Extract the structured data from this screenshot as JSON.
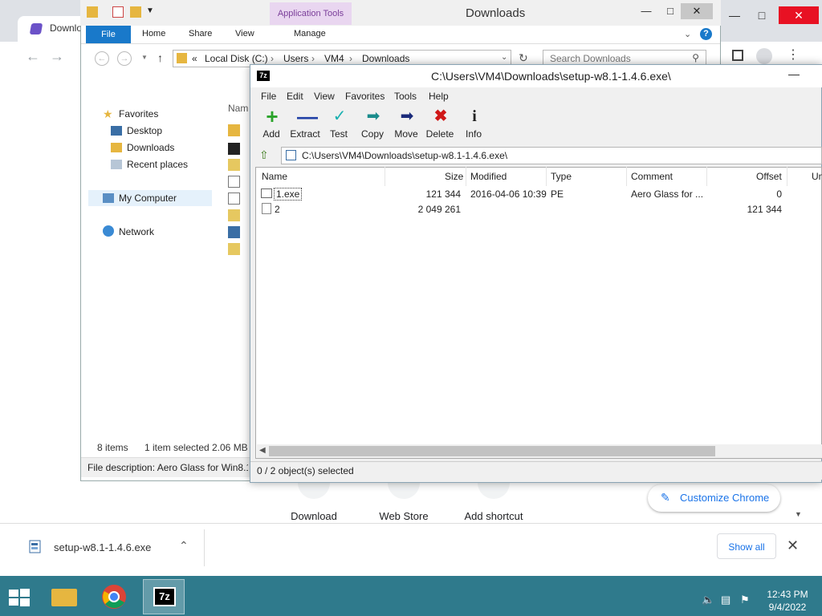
{
  "chrome": {
    "tab_title": "Downlo",
    "ntp_shortcuts": [
      "Download",
      "Web Store",
      "Add shortcut"
    ],
    "customize_label": "Customize Chrome",
    "download_shelf": {
      "filename": "setup-w8.1-1.4.6.exe",
      "show_all": "Show all"
    }
  },
  "explorer": {
    "title": "Downloads",
    "contextual_tab": "Application Tools",
    "ribbon_tabs": [
      "File",
      "Home",
      "Share",
      "View",
      "Manage"
    ],
    "breadcrumb": [
      "Local Disk (C:)",
      "Users",
      "VM4",
      "Downloads"
    ],
    "breadcrumb_overflow": "«",
    "search_placeholder": "Search Downloads",
    "nav": {
      "favorites": "Favorites",
      "desktop": "Desktop",
      "downloads": "Downloads",
      "recent": "Recent places",
      "mycomputer": "My Computer",
      "network": "Network"
    },
    "list_header_name": "Nam",
    "status_items": "8 items",
    "status_selected": "1 item selected",
    "status_size": "2.06 MB",
    "file_description": "File description: Aero Glass for Win8.1+"
  },
  "sevenzip": {
    "logo": "7z",
    "title": "C:\\Users\\VM4\\Downloads\\setup-w8.1-1.4.6.exe\\",
    "menu": [
      "File",
      "Edit",
      "View",
      "Favorites",
      "Tools",
      "Help"
    ],
    "toolbar": [
      "Add",
      "Extract",
      "Test",
      "Copy",
      "Move",
      "Delete",
      "Info"
    ],
    "path": "C:\\Users\\VM4\\Downloads\\setup-w8.1-1.4.6.exe\\",
    "columns": [
      "Name",
      "Size",
      "Modified",
      "Type",
      "Comment",
      "Offset",
      "Un"
    ],
    "rows": [
      {
        "name": "1.exe",
        "size": "121 344",
        "modified": "2016-04-06 10:39",
        "type": "PE",
        "comment": "Aero Glass for ...",
        "offset": "0"
      },
      {
        "name": "2",
        "size": "2 049 261",
        "modified": "",
        "type": "",
        "comment": "",
        "offset": "121 344"
      }
    ],
    "status": "0 / 2 object(s) selected"
  },
  "taskbar": {
    "time": "12:43 PM",
    "date": "9/4/2022"
  }
}
